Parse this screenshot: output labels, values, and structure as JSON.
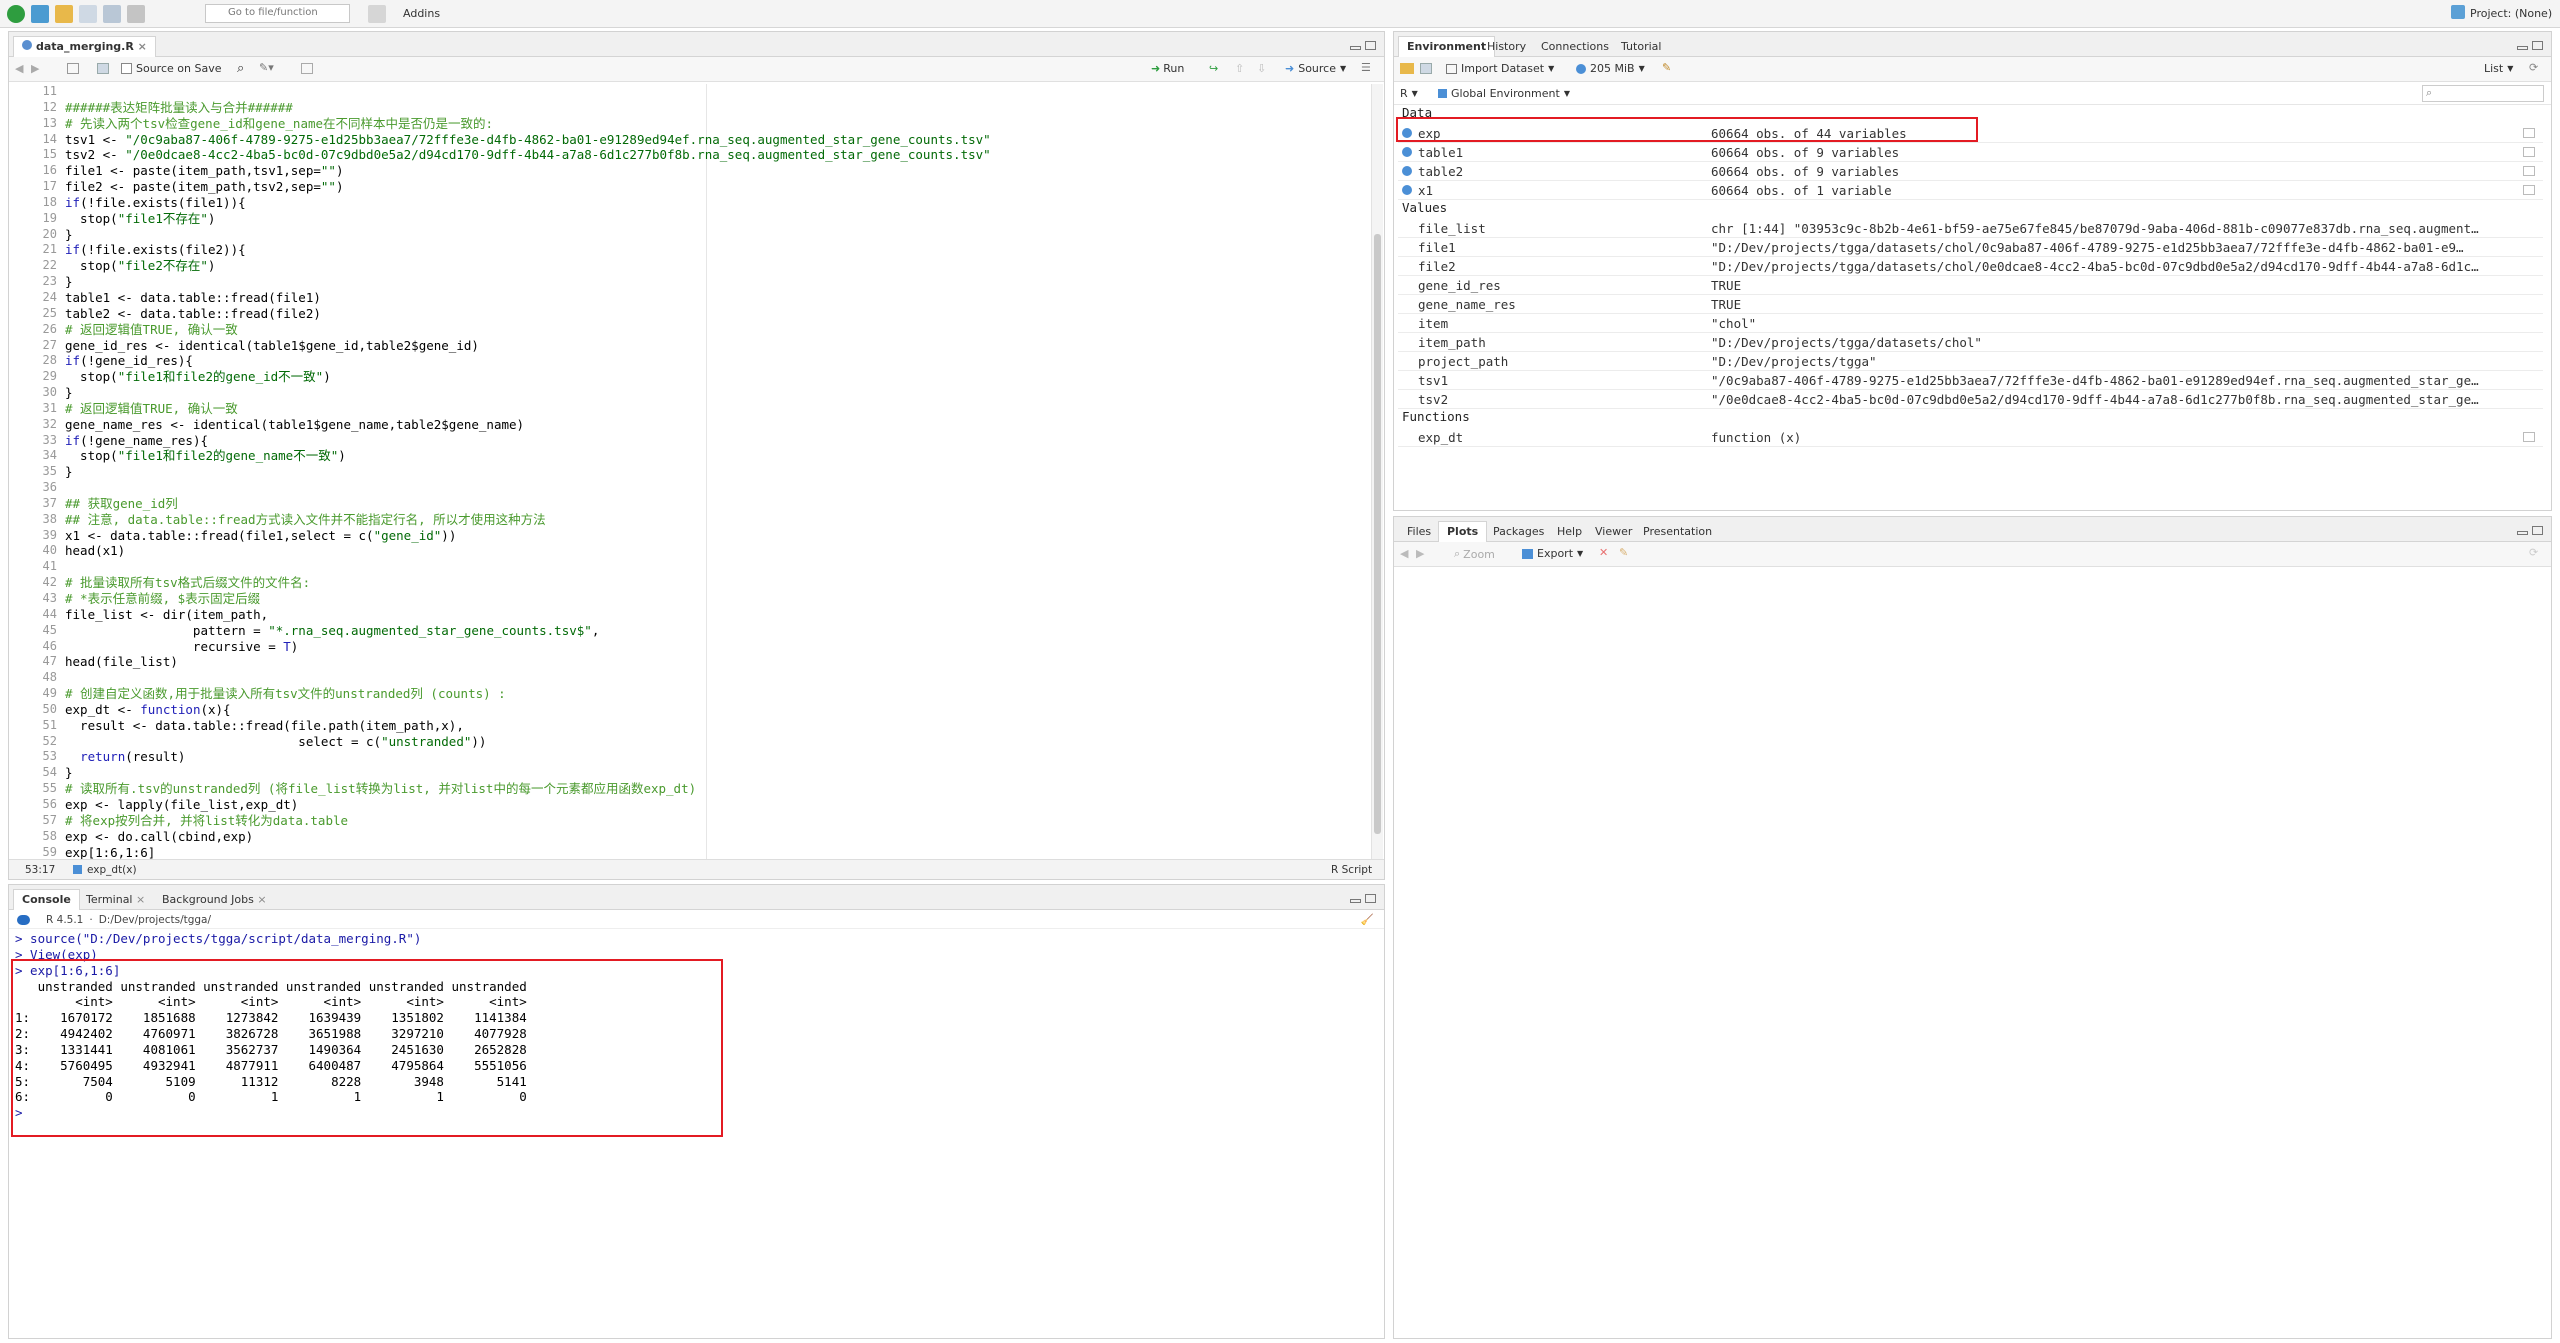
{
  "topbar": {
    "goto_placeholder": "Go to file/function",
    "addins_label": "Addins",
    "project_label": "Project: (None)"
  },
  "editor": {
    "tab_name": "data_merging.R",
    "source_on_save_label": "Source on Save",
    "run_label": "Run",
    "source_label": "Source",
    "status_position": "53:17",
    "status_scope": "exp_dt(x)",
    "status_filetype": "R Script",
    "lines": [
      {
        "n": "11",
        "t": "",
        "k": "plain"
      },
      {
        "n": "12",
        "t": "######表达矩阵批量读入与合并######",
        "k": "com"
      },
      {
        "n": "13",
        "t": "# 先读入两个tsv检查gene_id和gene_name在不同样本中是否仍是一致的:",
        "k": "com"
      },
      {
        "n": "14",
        "t": "tsv1 <- \"/0c9aba87-406f-4789-9275-e1d25bb3aea7/72fffe3e-d4fb-4862-ba01-e91289ed94ef.rna_seq.augmented_star_gene_counts.tsv\"",
        "k": "plain"
      },
      {
        "n": "15",
        "t": "tsv2 <- \"/0e0dcae8-4cc2-4ba5-bc0d-07c9dbd0e5a2/d94cd170-9dff-4b44-a7a8-6d1c277b0f8b.rna_seq.augmented_star_gene_counts.tsv\"",
        "k": "plain"
      },
      {
        "n": "16",
        "t": "file1 <- paste(item_path,tsv1,sep=\"\")",
        "k": "plain"
      },
      {
        "n": "17",
        "t": "file2 <- paste(item_path,tsv2,sep=\"\")",
        "k": "plain"
      },
      {
        "n": "18",
        "t": "if(!file.exists(file1)){",
        "k": "plain"
      },
      {
        "n": "19",
        "t": "  stop(\"file1不存在\")",
        "k": "plain"
      },
      {
        "n": "20",
        "t": "}",
        "k": "plain"
      },
      {
        "n": "21",
        "t": "if(!file.exists(file2)){",
        "k": "plain"
      },
      {
        "n": "22",
        "t": "  stop(\"file2不存在\")",
        "k": "plain"
      },
      {
        "n": "23",
        "t": "}",
        "k": "plain"
      },
      {
        "n": "24",
        "t": "table1 <- data.table::fread(file1)",
        "k": "plain"
      },
      {
        "n": "25",
        "t": "table2 <- data.table::fread(file2)",
        "k": "plain"
      },
      {
        "n": "26",
        "t": "# 返回逻辑值TRUE, 确认一致",
        "k": "com"
      },
      {
        "n": "27",
        "t": "gene_id_res <- identical(table1$gene_id,table2$gene_id)",
        "k": "plain"
      },
      {
        "n": "28",
        "t": "if(!gene_id_res){",
        "k": "plain"
      },
      {
        "n": "29",
        "t": "  stop(\"file1和file2的gene_id不一致\")",
        "k": "plain"
      },
      {
        "n": "30",
        "t": "}",
        "k": "plain"
      },
      {
        "n": "31",
        "t": "# 返回逻辑值TRUE, 确认一致",
        "k": "com"
      },
      {
        "n": "32",
        "t": "gene_name_res <- identical(table1$gene_name,table2$gene_name)",
        "k": "plain"
      },
      {
        "n": "33",
        "t": "if(!gene_name_res){",
        "k": "plain"
      },
      {
        "n": "34",
        "t": "  stop(\"file1和file2的gene_name不一致\")",
        "k": "plain"
      },
      {
        "n": "35",
        "t": "}",
        "k": "plain"
      },
      {
        "n": "36",
        "t": "",
        "k": "plain"
      },
      {
        "n": "37",
        "t": "## 获取gene_id列",
        "k": "com"
      },
      {
        "n": "38",
        "t": "## 注意, data.table::fread方式读入文件并不能指定行名, 所以才使用这种方法",
        "k": "com"
      },
      {
        "n": "39",
        "t": "x1 <- data.table::fread(file1,select = c(\"gene_id\"))",
        "k": "plain"
      },
      {
        "n": "40",
        "t": "head(x1)",
        "k": "plain"
      },
      {
        "n": "41",
        "t": "",
        "k": "plain"
      },
      {
        "n": "42",
        "t": "# 批量读取所有tsv格式后缀文件的文件名:",
        "k": "com"
      },
      {
        "n": "43",
        "t": "# *表示任意前缀, $表示固定后缀",
        "k": "com"
      },
      {
        "n": "44",
        "t": "file_list <- dir(item_path,",
        "k": "plain"
      },
      {
        "n": "45",
        "t": "                 pattern = \"*.rna_seq.augmented_star_gene_counts.tsv$\",",
        "k": "plain"
      },
      {
        "n": "46",
        "t": "                 recursive = T)",
        "k": "plain"
      },
      {
        "n": "47",
        "t": "head(file_list)",
        "k": "plain"
      },
      {
        "n": "48",
        "t": "",
        "k": "plain"
      },
      {
        "n": "49",
        "t": "# 创建自定义函数,用于批量读入所有tsv文件的unstranded列 (counts) :",
        "k": "com"
      },
      {
        "n": "50",
        "t": "exp_dt <- function(x){",
        "k": "plain"
      },
      {
        "n": "51",
        "t": "  result <- data.table::fread(file.path(item_path,x),",
        "k": "plain"
      },
      {
        "n": "52",
        "t": "                               select = c(\"unstranded\"))",
        "k": "plain"
      },
      {
        "n": "53",
        "t": "  return(result)",
        "k": "plain"
      },
      {
        "n": "54",
        "t": "}",
        "k": "plain"
      },
      {
        "n": "55",
        "t": "# 读取所有.tsv的unstranded列 (将file_list转换为list, 并对list中的每一个元素都应用函数exp_dt)",
        "k": "com"
      },
      {
        "n": "56",
        "t": "exp <- lapply(file_list,exp_dt)",
        "k": "plain"
      },
      {
        "n": "57",
        "t": "# 将exp按列合并, 并将list转化为data.table",
        "k": "com"
      },
      {
        "n": "58",
        "t": "exp <- do.call(cbind,exp)",
        "k": "plain"
      },
      {
        "n": "59",
        "t": "exp[1:6,1:6]",
        "k": "plain"
      }
    ]
  },
  "console": {
    "tabs": [
      "Console",
      "Terminal",
      "Background Jobs"
    ],
    "r_version": "R 4.5.1",
    "cwd": "D:/Dev/projects/tgga/",
    "lines": [
      "> source(\"D:/Dev/projects/tgga/script/data_merging.R\")",
      "> View(exp)",
      "> exp[1:6,1:6]",
      "   unstranded unstranded unstranded unstranded unstranded unstranded",
      "        <int>      <int>      <int>      <int>      <int>      <int>",
      "1:    1670172    1851688    1273842    1639439    1351802    1141384",
      "2:    4942402    4760971    3826728    3651988    3297210    4077928",
      "3:    1331441    4081061    3562737    1490364    2451630    2652828",
      "4:    5760495    4932941    4877911    6400487    4795864    5551056",
      "5:       7504       5109      11312       8228       3948       5141",
      "6:          0          0          1          1          1          0",
      "> "
    ]
  },
  "environment": {
    "tabs": [
      "Environment",
      "History",
      "Connections",
      "Tutorial"
    ],
    "import_dataset_label": "Import Dataset",
    "memory_label": "205 MiB",
    "list_label": "List",
    "lang_label": "R",
    "scope_label": "Global Environment",
    "sections": {
      "data": "Data",
      "values": "Values",
      "functions": "Functions"
    },
    "data_rows": [
      {
        "name": "exp",
        "value": "60664 obs. of 44 variables"
      },
      {
        "name": "table1",
        "value": "60664 obs. of 9 variables"
      },
      {
        "name": "table2",
        "value": "60664 obs. of 9 variables"
      },
      {
        "name": "x1",
        "value": "60664 obs. of 1 variable"
      }
    ],
    "value_rows": [
      {
        "name": "file_list",
        "value": "chr [1:44] \"03953c9c-8b2b-4e61-bf59-ae75e67fe845/be87079d-9aba-406d-881b-c09077e837db.rna_seq.augment…"
      },
      {
        "name": "file1",
        "value": "\"D:/Dev/projects/tgga/datasets/chol/0c9aba87-406f-4789-9275-e1d25bb3aea7/72fffe3e-d4fb-4862-ba01-e9…"
      },
      {
        "name": "file2",
        "value": "\"D:/Dev/projects/tgga/datasets/chol/0e0dcae8-4cc2-4ba5-bc0d-07c9dbd0e5a2/d94cd170-9dff-4b44-a7a8-6d1c…"
      },
      {
        "name": "gene_id_res",
        "value": "TRUE"
      },
      {
        "name": "gene_name_res",
        "value": "TRUE"
      },
      {
        "name": "item",
        "value": "\"chol\""
      },
      {
        "name": "item_path",
        "value": "\"D:/Dev/projects/tgga/datasets/chol\""
      },
      {
        "name": "project_path",
        "value": "\"D:/Dev/projects/tgga\""
      },
      {
        "name": "tsv1",
        "value": "\"/0c9aba87-406f-4789-9275-e1d25bb3aea7/72fffe3e-d4fb-4862-ba01-e91289ed94ef.rna_seq.augmented_star_ge…"
      },
      {
        "name": "tsv2",
        "value": "\"/0e0dcae8-4cc2-4ba5-bc0d-07c9dbd0e5a2/d94cd170-9dff-4b44-a7a8-6d1c277b0f8b.rna_seq.augmented_star_ge…"
      }
    ],
    "function_rows": [
      {
        "name": "exp_dt",
        "value": "function (x)"
      }
    ]
  },
  "files": {
    "tabs": [
      "Files",
      "Plots",
      "Packages",
      "Help",
      "Viewer",
      "Presentation"
    ],
    "zoom_label": "Zoom",
    "export_label": "Export"
  },
  "colors": {
    "highlight_box": "#e31b23",
    "comment": "#4a9a2e",
    "string": "#036a07",
    "keyword": "#2121b8"
  }
}
